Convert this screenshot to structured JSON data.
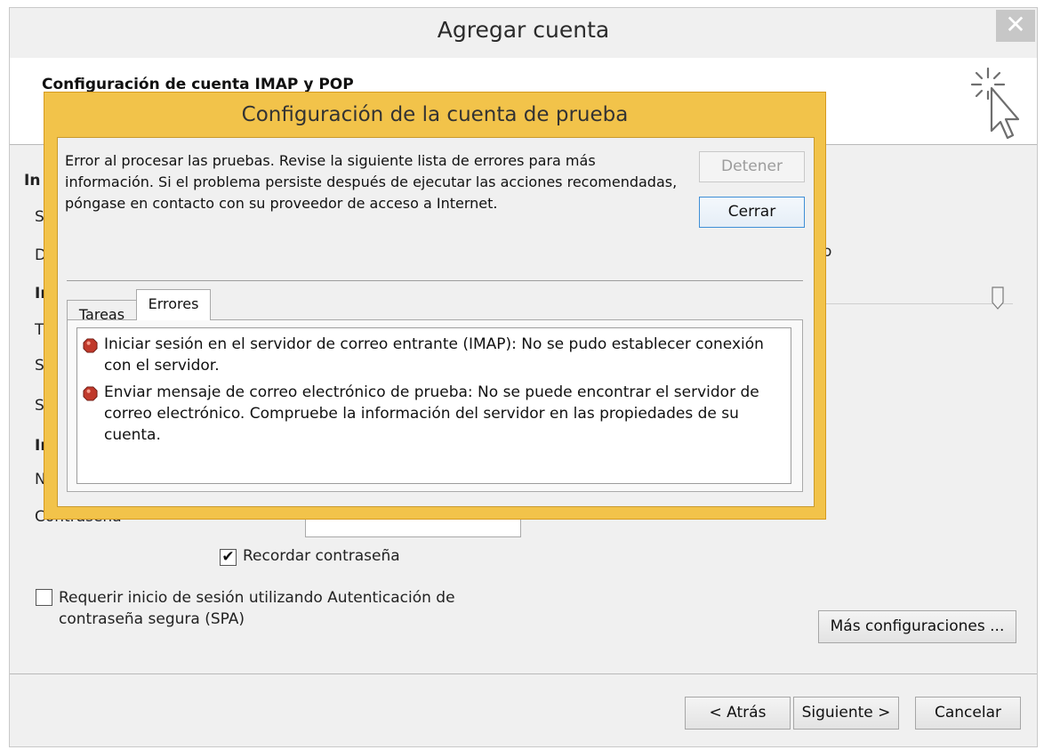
{
  "window": {
    "title": "Agregar cuenta",
    "close_glyph": "✕",
    "header_title": "Configuración de cuenta IMAP y POP",
    "header_icon": "wand-cursor-icon"
  },
  "background": {
    "partial_labels": [
      "In",
      "S",
      "D",
      "In",
      "T",
      "S",
      "S",
      "In",
      "N"
    ],
    "right_fragment": "o",
    "password_label": "Contraseña",
    "password_value": "**********",
    "remember_password": {
      "label": "Recordar contraseña",
      "checked": true
    },
    "spa": {
      "label": "Requerir inicio de sesión utilizando Autenticación de contraseña segura (SPA)",
      "checked": false
    },
    "more_settings_button": "Más configuraciones ...",
    "nav": {
      "back": "< Atrás",
      "next": "Siguiente >",
      "cancel": "Cancelar"
    }
  },
  "modal": {
    "title": "Configuración de la cuenta de prueba",
    "message": "Error al procesar las pruebas. Revise la siguiente lista de errores para más información. Si el problema persiste después de ejecutar las acciones recomendadas, póngase en contacto con su proveedor de acceso a Internet.",
    "stop_button": "Detener",
    "close_button": "Cerrar",
    "tabs": [
      {
        "label": "Tareas",
        "active": false
      },
      {
        "label": "Errores",
        "active": true
      }
    ],
    "errors": [
      {
        "icon": "error-icon",
        "text": "Iniciar sesión en el servidor de correo entrante (IMAP): No se pudo establecer conexión con el servidor."
      },
      {
        "icon": "error-icon",
        "text": "Enviar mensaje de correo electrónico de prueba: No se puede encontrar el servidor de correo electrónico. Compruebe la información del servidor en las propiedades de su cuenta."
      }
    ]
  },
  "colors": {
    "modal_frame": "#f2c34a",
    "error_icon": "#c0392b",
    "focus_border": "#3f8fd6"
  }
}
